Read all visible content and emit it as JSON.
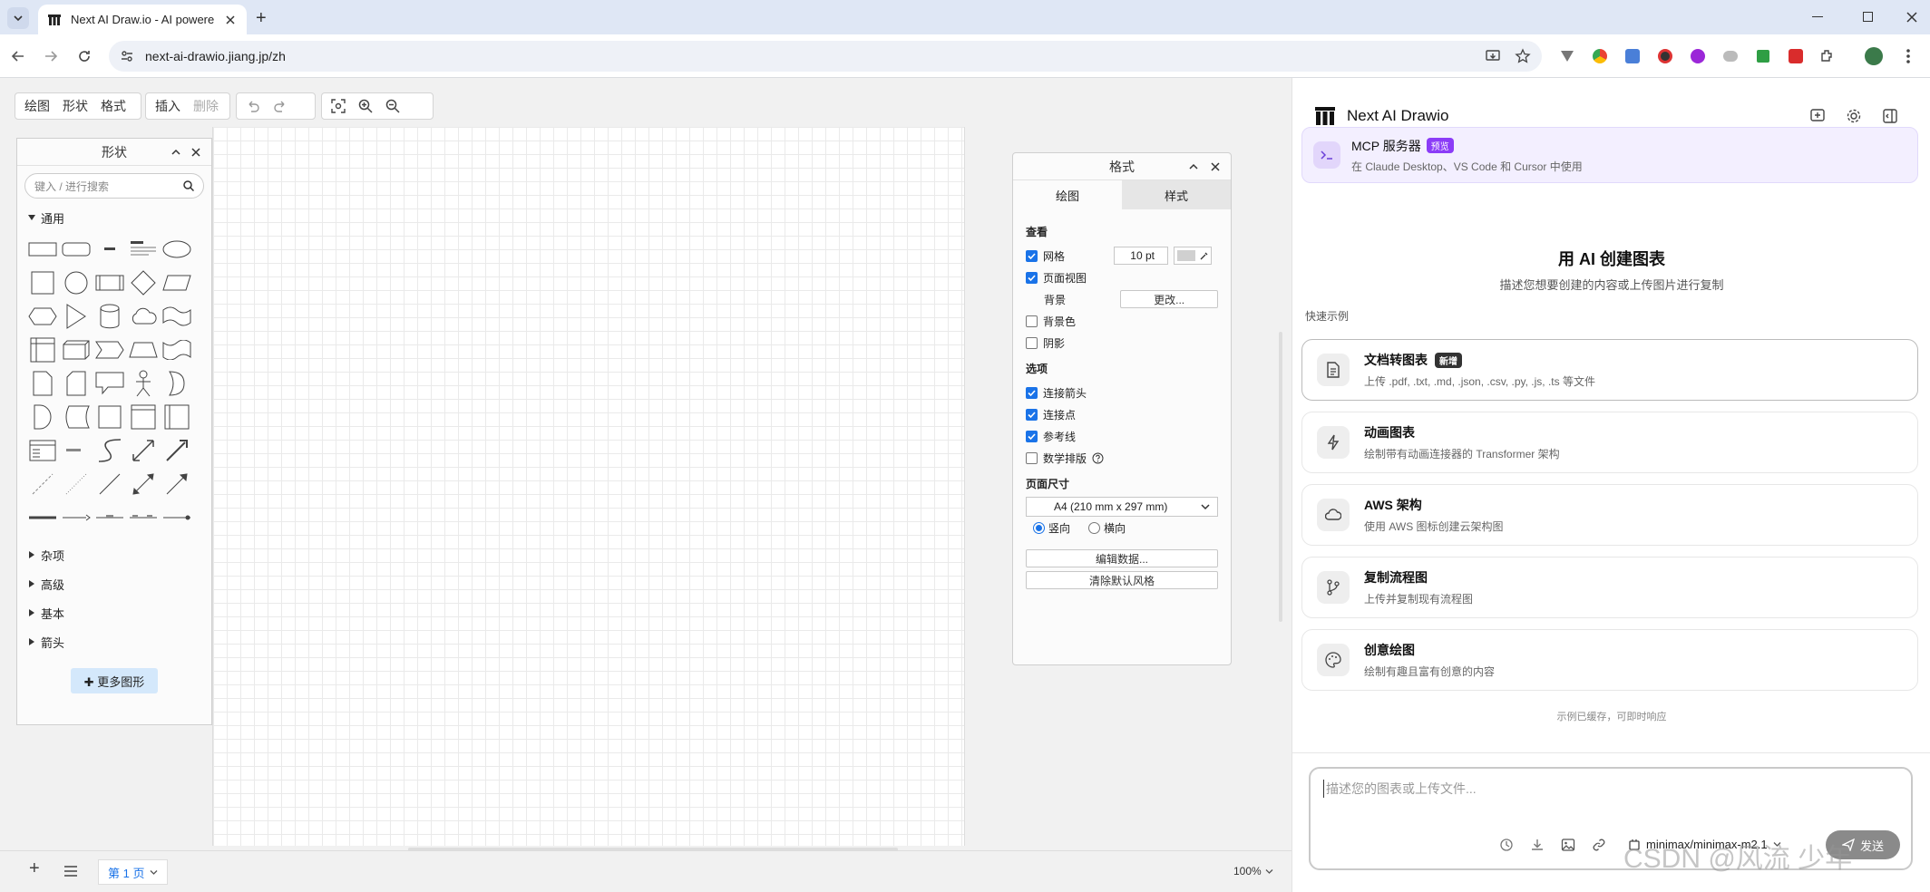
{
  "browser": {
    "tab_title": "Next AI Draw.io - AI powere",
    "url": "next-ai-drawio.jiang.jp/zh"
  },
  "toolbar": {
    "diagram": "绘图",
    "shape": "形状",
    "format": "格式",
    "insert": "插入",
    "delete": "删除"
  },
  "shapes_panel": {
    "title": "形状",
    "search_placeholder": "键入 / 进行搜索",
    "general": "通用",
    "sections": [
      "杂项",
      "高级",
      "基本",
      "箭头"
    ],
    "more_shapes": "✚ 更多图形"
  },
  "format_panel": {
    "title": "格式",
    "tab_diagram": "绘图",
    "tab_style": "样式",
    "view_heading": "查看",
    "grid": "网格",
    "grid_size": "10 pt",
    "page_view": "页面视图",
    "background": "背景",
    "change_button": "更改...",
    "bg_color": "背景色",
    "shadow": "阴影",
    "options_heading": "选项",
    "connection_arrows": "连接箭头",
    "connection_points": "连接点",
    "guides": "参考线",
    "math": "数学排版",
    "page_size_heading": "页面尺寸",
    "page_size_value": "A4 (210 mm x 297 mm)",
    "portrait": "竖向",
    "landscape": "横向",
    "edit_data": "编辑数据...",
    "clear_style": "清除默认风格"
  },
  "bottom": {
    "page_tab": "第 1 页",
    "zoom": "100%"
  },
  "ai_panel": {
    "brand": "Next AI Drawio",
    "mcp_title": "MCP 服务器",
    "mcp_badge": "预览",
    "mcp_desc": "在 Claude Desktop、VS Code 和 Cursor 中使用",
    "heading": "用 AI 创建图表",
    "subheading": "描述您想要创建的内容或上传图片进行复制",
    "examples_label": "快速示例",
    "examples": [
      {
        "title": "文档转图表",
        "badge": "新增",
        "desc": "上传 .pdf, .txt, .md, .json, .csv, .py, .js, .ts 等文件"
      },
      {
        "title": "动画图表",
        "badge": "",
        "desc": "绘制带有动画连接器的 Transformer 架构"
      },
      {
        "title": "AWS 架构",
        "badge": "",
        "desc": "使用 AWS 图标创建云架构图"
      },
      {
        "title": "复制流程图",
        "badge": "",
        "desc": "上传并复制现有流程图"
      },
      {
        "title": "创意绘图",
        "badge": "",
        "desc": "绘制有趣且富有创意的内容"
      }
    ],
    "cache_note": "示例已缓存，可即时响应",
    "input_placeholder": "描述您的图表或上传文件...",
    "model": "minimax/minimax-m2.1",
    "send": "发送"
  },
  "watermark": "CSDN @风流 少年",
  "colors": {
    "accent": "#1a73e8",
    "mcp_bg": "#f3efff",
    "mcp_badge": "#8b3cf7",
    "more_shapes_bg": "#d4e8fb"
  }
}
